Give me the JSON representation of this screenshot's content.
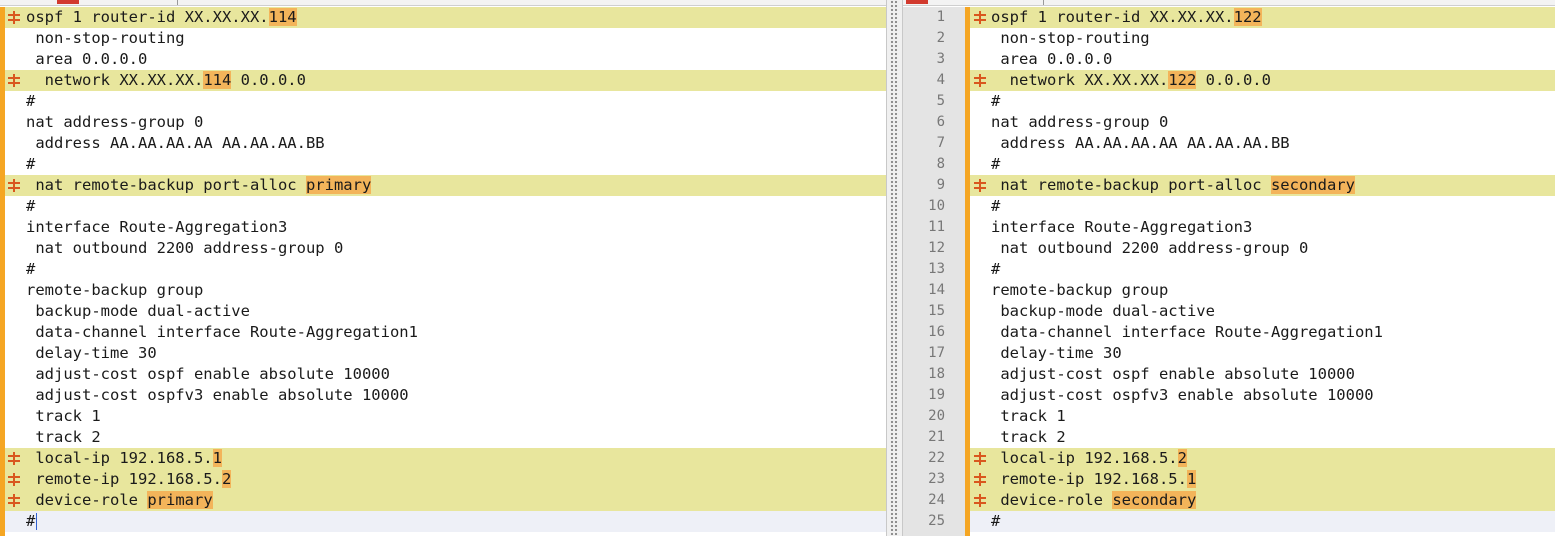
{
  "left_pane": {
    "lines": [
      {
        "parts": [
          {
            "t": "ospf 1 router-id XX.XX.XX."
          },
          {
            "t": "114",
            "hl": true
          }
        ],
        "diff": true
      },
      {
        "parts": [
          {
            "t": " non-stop-routing"
          }
        ]
      },
      {
        "parts": [
          {
            "t": " area 0.0.0.0"
          }
        ]
      },
      {
        "parts": [
          {
            "t": "  network XX.XX.XX."
          },
          {
            "t": "114",
            "hl": true
          },
          {
            "t": " 0.0.0.0"
          }
        ],
        "diff": true
      },
      {
        "parts": [
          {
            "t": "#"
          }
        ]
      },
      {
        "parts": [
          {
            "t": "nat address-group 0"
          }
        ]
      },
      {
        "parts": [
          {
            "t": " address AA.AA.AA.AA AA.AA.AA.BB"
          }
        ]
      },
      {
        "parts": [
          {
            "t": "#"
          }
        ]
      },
      {
        "parts": [
          {
            "t": " nat remote-backup port-alloc "
          },
          {
            "t": "primary",
            "hl": true
          }
        ],
        "diff": true
      },
      {
        "parts": [
          {
            "t": "#"
          }
        ]
      },
      {
        "parts": [
          {
            "t": "interface Route-Aggregation3"
          }
        ]
      },
      {
        "parts": [
          {
            "t": " nat outbound 2200 address-group 0"
          }
        ]
      },
      {
        "parts": [
          {
            "t": "#"
          }
        ]
      },
      {
        "parts": [
          {
            "t": "remote-backup group"
          }
        ]
      },
      {
        "parts": [
          {
            "t": " backup-mode dual-active"
          }
        ]
      },
      {
        "parts": [
          {
            "t": " data-channel interface Route-Aggregation1"
          }
        ]
      },
      {
        "parts": [
          {
            "t": " delay-time 30"
          }
        ]
      },
      {
        "parts": [
          {
            "t": " adjust-cost ospf enable absolute 10000"
          }
        ]
      },
      {
        "parts": [
          {
            "t": " adjust-cost ospfv3 enable absolute 10000"
          }
        ]
      },
      {
        "parts": [
          {
            "t": " track 1"
          }
        ]
      },
      {
        "parts": [
          {
            "t": " track 2"
          }
        ]
      },
      {
        "parts": [
          {
            "t": " local-ip 192.168.5."
          },
          {
            "t": "1",
            "hl": true
          }
        ],
        "diff": true
      },
      {
        "parts": [
          {
            "t": " remote-ip 192.168.5."
          },
          {
            "t": "2",
            "hl": true
          }
        ],
        "diff": true
      },
      {
        "parts": [
          {
            "t": " device-role "
          },
          {
            "t": "primary",
            "hl": true
          }
        ],
        "diff": true
      },
      {
        "parts": [
          {
            "t": "#"
          }
        ],
        "last": true,
        "cursor": true
      }
    ]
  },
  "right_pane": {
    "lines": [
      {
        "num": "1",
        "parts": [
          {
            "t": "ospf 1 router-id XX.XX.XX."
          },
          {
            "t": "122",
            "hl": true
          }
        ],
        "diff": true
      },
      {
        "num": "2",
        "parts": [
          {
            "t": " non-stop-routing"
          }
        ]
      },
      {
        "num": "3",
        "parts": [
          {
            "t": " area 0.0.0.0"
          }
        ]
      },
      {
        "num": "4",
        "parts": [
          {
            "t": "  network XX.XX.XX."
          },
          {
            "t": "122",
            "hl": true
          },
          {
            "t": " 0.0.0.0"
          }
        ],
        "diff": true
      },
      {
        "num": "5",
        "parts": [
          {
            "t": "#"
          }
        ]
      },
      {
        "num": "6",
        "parts": [
          {
            "t": "nat address-group 0"
          }
        ]
      },
      {
        "num": "7",
        "parts": [
          {
            "t": " address AA.AA.AA.AA AA.AA.AA.BB"
          }
        ]
      },
      {
        "num": "8",
        "parts": [
          {
            "t": "#"
          }
        ]
      },
      {
        "num": "9",
        "parts": [
          {
            "t": " nat remote-backup port-alloc "
          },
          {
            "t": "secondary",
            "hl": true
          }
        ],
        "diff": true
      },
      {
        "num": "10",
        "parts": [
          {
            "t": "#"
          }
        ]
      },
      {
        "num": "11",
        "parts": [
          {
            "t": "interface Route-Aggregation3"
          }
        ]
      },
      {
        "num": "12",
        "parts": [
          {
            "t": " nat outbound 2200 address-group 0"
          }
        ]
      },
      {
        "num": "13",
        "parts": [
          {
            "t": "#"
          }
        ]
      },
      {
        "num": "14",
        "parts": [
          {
            "t": "remote-backup group"
          }
        ]
      },
      {
        "num": "15",
        "parts": [
          {
            "t": " backup-mode dual-active"
          }
        ]
      },
      {
        "num": "16",
        "parts": [
          {
            "t": " data-channel interface Route-Aggregation1"
          }
        ]
      },
      {
        "num": "17",
        "parts": [
          {
            "t": " delay-time 30"
          }
        ]
      },
      {
        "num": "18",
        "parts": [
          {
            "t": " adjust-cost ospf enable absolute 10000"
          }
        ]
      },
      {
        "num": "19",
        "parts": [
          {
            "t": " adjust-cost ospfv3 enable absolute 10000"
          }
        ]
      },
      {
        "num": "20",
        "parts": [
          {
            "t": " track 1"
          }
        ]
      },
      {
        "num": "21",
        "parts": [
          {
            "t": " track 2"
          }
        ]
      },
      {
        "num": "22",
        "parts": [
          {
            "t": " local-ip 192.168.5."
          },
          {
            "t": "2",
            "hl": true
          }
        ],
        "diff": true
      },
      {
        "num": "23",
        "parts": [
          {
            "t": " remote-ip 192.168.5."
          },
          {
            "t": "1",
            "hl": true
          }
        ],
        "diff": true
      },
      {
        "num": "24",
        "parts": [
          {
            "t": " device-role "
          },
          {
            "t": "secondary",
            "hl": true
          }
        ],
        "diff": true
      },
      {
        "num": "25",
        "parts": [
          {
            "t": "#"
          }
        ],
        "last": true
      }
    ]
  },
  "colors": {
    "diff_line": "#e8e69d",
    "diff_token": "#f3b45a",
    "gutter_accent": "#f5a623",
    "diff_marker": "#d9571e"
  },
  "icons": {
    "diff_marker": "diff-marker-icon"
  }
}
